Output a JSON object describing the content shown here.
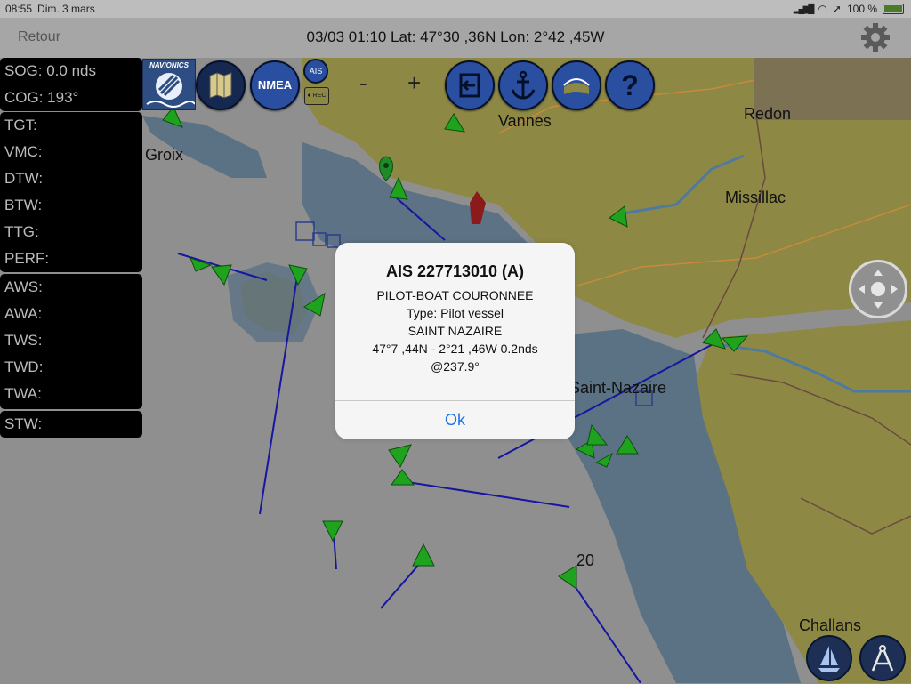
{
  "status_bar": {
    "time": "08:55",
    "date": "Dim. 3 mars",
    "battery": "100 %"
  },
  "nav": {
    "back_label": "Retour",
    "title": "03/03 01:10  Lat: 47°30 ,36N Lon: 2°42 ,45W"
  },
  "toolbar": {
    "brand": "NAVIONICS",
    "nmea": "NMEA",
    "ais": "AIS",
    "rec": "● REC",
    "zoom_out": "-",
    "zoom_in": "+",
    "help": "?"
  },
  "instruments": {
    "nav": [
      {
        "label": "SOG: 0.0 nds"
      },
      {
        "label": "COG: 193°"
      }
    ],
    "route": [
      {
        "label": "TGT:"
      },
      {
        "label": "VMC:"
      },
      {
        "label": "DTW:"
      },
      {
        "label": "BTW:"
      },
      {
        "label": "TTG:"
      },
      {
        "label": "PERF:"
      }
    ],
    "wind": [
      {
        "label": "AWS:"
      },
      {
        "label": "AWA:"
      },
      {
        "label": "TWS:"
      },
      {
        "label": "TWD:"
      },
      {
        "label": "TWA:"
      }
    ],
    "speed": [
      {
        "label": "STW:"
      }
    ]
  },
  "map": {
    "places": [
      "Groix",
      "Vannes",
      "Redon",
      "Missillac",
      "Saint-Nazaire",
      "Challans"
    ],
    "depth_label": "20"
  },
  "alert": {
    "title": "AIS 227713010 (A)",
    "lines": [
      "PILOT-BOAT COURONNEE",
      "Type: Pilot vessel",
      "SAINT NAZAIRE",
      "47°7 ,44N - 2°21 ,46W 0.2nds",
      "@237.9°"
    ],
    "ok_label": "Ok"
  }
}
